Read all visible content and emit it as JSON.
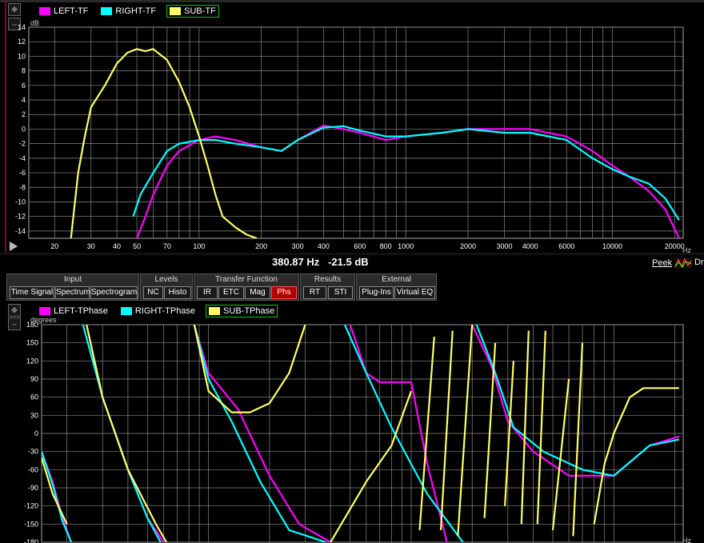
{
  "top_graph": {
    "legend": [
      {
        "label": "LEFT-TF",
        "color": "#ff00ff"
      },
      {
        "label": "RIGHT-TF",
        "color": "#00ffff"
      },
      {
        "label": "SUB-TF",
        "color": "#ffff66",
        "selected": true
      }
    ],
    "y_unit": "dB",
    "x_unit": "Hz"
  },
  "readout": {
    "text": "380.87 Hz   -21.5 dB"
  },
  "peek": {
    "label": "Peek",
    "icon": "peek-wave-icon"
  },
  "dr_label": "Dr",
  "toolbar": {
    "groups": [
      {
        "title": "Input",
        "buttons": [
          "Time Signal",
          "Spectrum",
          "Spectrogram"
        ]
      },
      {
        "title": "Levels",
        "buttons": [
          "NC",
          "Histo"
        ]
      },
      {
        "title": "Transfer Function",
        "buttons": [
          "IR",
          "ETC",
          "Mag",
          "Phs"
        ],
        "active": "Phs"
      },
      {
        "title": "Results",
        "buttons": [
          "RT",
          "STI"
        ]
      },
      {
        "title": "External",
        "buttons": [
          "Plug-Ins",
          "Virtual EQ"
        ]
      }
    ]
  },
  "bottom_graph": {
    "legend": [
      {
        "label": "LEFT-TPhase",
        "color": "#ff00ff"
      },
      {
        "label": "RIGHT-TPhase",
        "color": "#00ffff"
      },
      {
        "label": "SUB-TPhase",
        "color": "#ffff66",
        "selected": true
      }
    ],
    "y_unit": "degrees",
    "x_unit": "Hz"
  },
  "chart_data": [
    {
      "type": "line",
      "title": "",
      "xlabel": "Hz",
      "ylabel": "dB",
      "x_scale": "log",
      "xlim": [
        15,
        22000
      ],
      "ylim": [
        -15,
        14
      ],
      "x_tick_labels": [
        "20",
        "30",
        "40",
        "50",
        "70",
        "100",
        "200",
        "300",
        "400",
        "600",
        "800",
        "1000",
        "2000",
        "3000",
        "4000",
        "6000",
        "10000",
        "20000"
      ],
      "y_tick_labels": [
        "14",
        "12",
        "10",
        "8",
        "6",
        "4",
        "2",
        "0",
        "-2",
        "-4",
        "-6",
        "-8",
        "-10",
        "-12",
        "-14"
      ],
      "grid": true,
      "series": [
        {
          "name": "LEFT-TF",
          "color": "#ff00ff",
          "x": [
            50,
            55,
            60,
            70,
            80,
            100,
            120,
            150,
            200,
            250,
            300,
            400,
            500,
            600,
            800,
            1000,
            1500,
            2000,
            3000,
            4000,
            6000,
            8000,
            10000,
            12000,
            15000,
            18000,
            21000
          ],
          "y": [
            -15,
            -12,
            -9,
            -5,
            -3,
            -1.5,
            -1,
            -1.5,
            -2.5,
            -3,
            -1.5,
            0.5,
            0,
            -0.5,
            -1.5,
            -1,
            -0.5,
            0,
            0,
            0,
            -1,
            -3,
            -5,
            -6.5,
            -8.5,
            -11,
            -15
          ]
        },
        {
          "name": "RIGHT-TF",
          "color": "#00ffff",
          "x": [
            48,
            52,
            60,
            70,
            80,
            100,
            120,
            150,
            200,
            250,
            300,
            400,
            500,
            600,
            800,
            1000,
            1500,
            2000,
            3000,
            4000,
            6000,
            8000,
            10000,
            12000,
            15000,
            18000,
            21000
          ],
          "y": [
            -12,
            -9,
            -6,
            -3,
            -2,
            -1.5,
            -1.5,
            -2,
            -2.5,
            -3,
            -1.5,
            0.2,
            0.4,
            -0.2,
            -1,
            -1,
            -0.5,
            0,
            -0.5,
            -0.5,
            -1.5,
            -4,
            -5.5,
            -6.5,
            -7.5,
            -9.5,
            -12.5
          ]
        },
        {
          "name": "SUB-TF",
          "color": "#ffff66",
          "x": [
            24,
            26,
            28,
            30,
            35,
            40,
            45,
            50,
            55,
            60,
            70,
            80,
            90,
            100,
            110,
            120,
            130,
            150,
            170,
            190
          ],
          "y": [
            -15,
            -6,
            -1,
            3,
            6,
            9,
            10.5,
            11,
            10.7,
            11,
            9.5,
            6.5,
            3,
            -1,
            -5,
            -9,
            -12,
            -13.5,
            -14.5,
            -15
          ]
        }
      ]
    },
    {
      "type": "line",
      "title": "",
      "xlabel": "Hz",
      "ylabel": "degrees",
      "x_scale": "log",
      "xlim": [
        15,
        22000
      ],
      "ylim": [
        -180,
        180
      ],
      "y_tick_labels": [
        "180",
        "150",
        "120",
        "90",
        "60",
        "30",
        "0",
        "-30",
        "-60",
        "-90",
        "-120",
        "-150",
        "-180"
      ],
      "grid": true,
      "series": [
        {
          "name": "LEFT-TPhase",
          "color": "#ff00ff",
          "segments": [
            {
              "x": [
                15,
                17,
                19,
                21
              ],
              "y": [
                -30,
                -80,
                -140,
                -180
              ]
            },
            {
              "x": [
                25,
                30,
                40,
                50,
                60
              ],
              "y": [
                180,
                60,
                -60,
                -140,
                -180
              ]
            },
            {
              "x": [
                85,
                100,
                140,
                200,
                280,
                400
              ],
              "y": [
                180,
                100,
                40,
                -70,
                -150,
                -180
              ]
            },
            {
              "x": [
                500,
                600,
                700,
                1000,
                1200,
                1500
              ],
              "y": [
                180,
                100,
                85,
                85,
                -50,
                -180
              ]
            },
            {
              "x": [
                2000,
                2500,
                3000,
                4000,
                6000,
                10000,
                15000,
                21000
              ],
              "y": [
                180,
                110,
                20,
                -30,
                -70,
                -70,
                -20,
                -5
              ]
            }
          ]
        },
        {
          "name": "RIGHT-TPhase",
          "color": "#00ffff",
          "segments": [
            {
              "x": [
                15,
                17,
                19,
                21
              ],
              "y": [
                -30,
                -85,
                -145,
                -180
              ]
            },
            {
              "x": [
                24,
                30,
                40,
                50,
                58
              ],
              "y": [
                180,
                60,
                -60,
                -140,
                -180
              ]
            },
            {
              "x": [
                85,
                100,
                130,
                180,
                250,
                380
              ],
              "y": [
                180,
                90,
                20,
                -80,
                -160,
                -180
              ]
            },
            {
              "x": [
                470,
                600,
                800,
                1200,
                1800
              ],
              "y": [
                180,
                100,
                10,
                -100,
                -180
              ]
            },
            {
              "x": [
                2100,
                2600,
                3200,
                4500,
                7000,
                10000,
                15000,
                21000
              ],
              "y": [
                180,
                100,
                10,
                -30,
                -60,
                -70,
                -20,
                -10
              ]
            }
          ]
        },
        {
          "name": "SUB-TPhase",
          "color": "#ffff66",
          "segments": [
            {
              "x": [
                15,
                17,
                20
              ],
              "y": [
                -40,
                -100,
                -150
              ]
            },
            {
              "x": [
                25,
                30,
                40,
                55,
                62
              ],
              "y": [
                180,
                60,
                -60,
                -150,
                -180
              ]
            },
            {
              "x": [
                85,
                100,
                130,
                160,
                200,
                250,
                300
              ],
              "y": [
                180,
                70,
                35,
                35,
                50,
                100,
                180
              ]
            },
            {
              "x": [
                400,
                600,
                800,
                1000
              ],
              "y": [
                -180,
                -80,
                -20,
                70
              ]
            },
            {
              "x": [
                1100,
                1300
              ],
              "y": [
                -160,
                160
              ]
            },
            {
              "x": [
                1400,
                1600
              ],
              "y": [
                -160,
                170
              ]
            },
            {
              "x": [
                1700,
                2000
              ],
              "y": [
                -170,
                180
              ]
            },
            {
              "x": [
                2300,
                2600
              ],
              "y": [
                -140,
                150
              ]
            },
            {
              "x": [
                2900,
                3200
              ],
              "y": [
                -120,
                120
              ]
            },
            {
              "x": [
                3500,
                3800
              ],
              "y": [
                -150,
                170
              ]
            },
            {
              "x": [
                4200,
                4600
              ],
              "y": [
                -150,
                170
              ]
            },
            {
              "x": [
                5000,
                6000
              ],
              "y": [
                -160,
                90
              ]
            },
            {
              "x": [
                6300,
                7000
              ],
              "y": [
                -170,
                150
              ]
            },
            {
              "x": [
                8000,
                9000,
                10000,
                12000,
                14000,
                17000,
                21000
              ],
              "y": [
                -150,
                -50,
                0,
                60,
                75,
                75,
                75
              ]
            }
          ]
        }
      ]
    }
  ]
}
